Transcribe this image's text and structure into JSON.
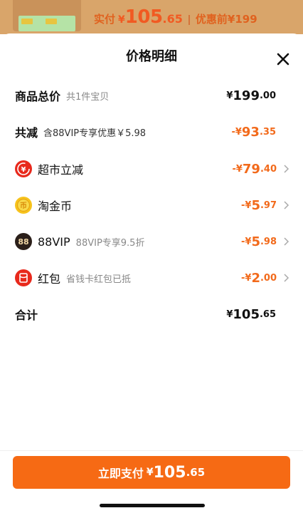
{
  "backdrop": {
    "actual_label": "实付",
    "currency": "¥",
    "actual_int": "105",
    "actual_dec": ".65",
    "original_label": "优惠前",
    "original_price": "¥199"
  },
  "sheet": {
    "title": "价格明细"
  },
  "rows": [
    {
      "title": "商品总价",
      "subtitle": "共1件宝贝",
      "currency": "¥",
      "int": "199",
      "dec": ".00",
      "color": "#111111"
    },
    {
      "title": "共减",
      "subtitle": "含88VIP专享优惠￥5.98",
      "currency": "-¥",
      "int": "93",
      "dec": ".35",
      "color": "#f26a1b"
    },
    {
      "title": "超市立减",
      "subtitle": "",
      "icon": "supermarket-discount-icon",
      "currency": "-¥",
      "int": "79",
      "dec": ".40",
      "color": "#f26a1b"
    },
    {
      "title": "淘金币",
      "subtitle": "",
      "icon": "gold-coin-icon",
      "currency": "-¥",
      "int": "5",
      "dec": ".97",
      "color": "#f26a1b"
    },
    {
      "title": "88VIP",
      "subtitle": "88VIP专享9.5折",
      "icon": "88vip-icon",
      "currency": "-¥",
      "int": "5",
      "dec": ".98",
      "color": "#f26a1b"
    },
    {
      "title": "红包",
      "subtitle": "省钱卡红包已抵",
      "icon": "red-packet-icon",
      "currency": "-¥",
      "int": "2",
      "dec": ".00",
      "color": "#f26a1b"
    },
    {
      "title": "合计",
      "subtitle": "",
      "currency": "¥",
      "int": "105",
      "dec": ".65",
      "color": "#111111"
    }
  ],
  "icons": {
    "supermarket_glyph": "¥",
    "coin_glyph": "币",
    "vip_glyph": "88"
  },
  "pay_button": {
    "label": "立即支付",
    "currency": "¥",
    "int": "105",
    "dec": ".65"
  }
}
